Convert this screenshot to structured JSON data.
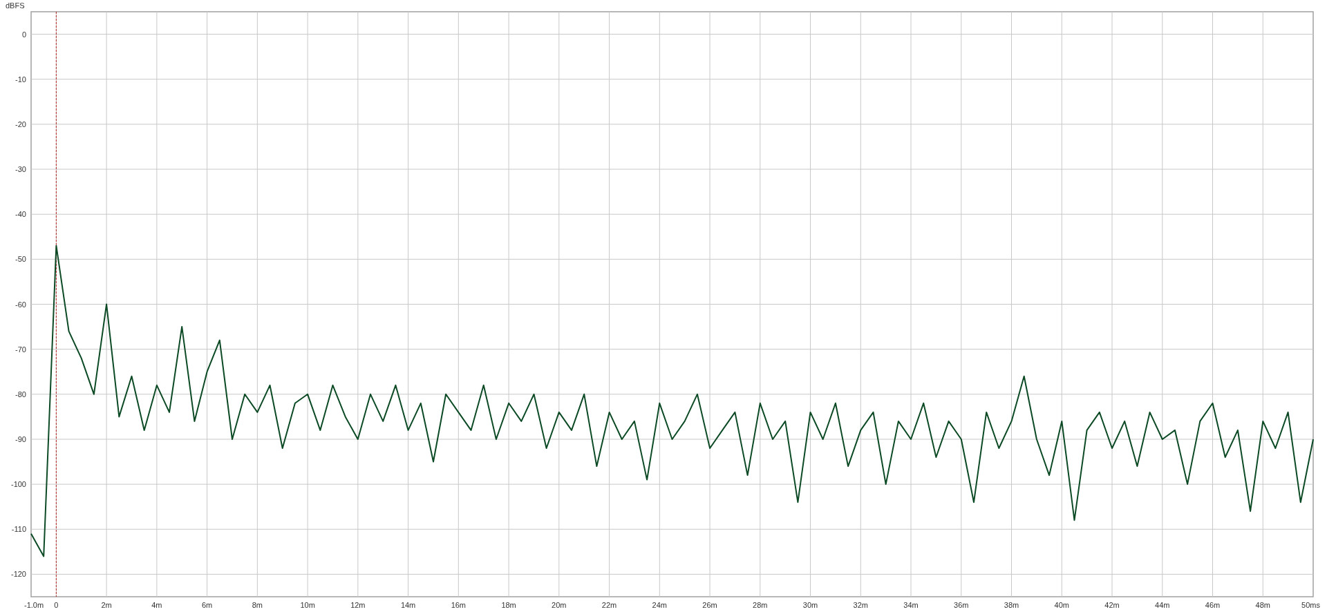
{
  "chart_data": {
    "type": "line",
    "ylabel": "dBFS",
    "xlim": [
      -1,
      50
    ],
    "ylim": [
      -125,
      5
    ],
    "grid": true,
    "ref_lines": [
      {
        "axis": "x",
        "value": 0,
        "color": "#b22222"
      }
    ],
    "xticks": [
      {
        "value": -1,
        "label": "-1.0m"
      },
      {
        "value": 0,
        "label": "0"
      },
      {
        "value": 2,
        "label": "2m"
      },
      {
        "value": 4,
        "label": "4m"
      },
      {
        "value": 6,
        "label": "6m"
      },
      {
        "value": 8,
        "label": "8m"
      },
      {
        "value": 10,
        "label": "10m"
      },
      {
        "value": 12,
        "label": "12m"
      },
      {
        "value": 14,
        "label": "14m"
      },
      {
        "value": 16,
        "label": "16m"
      },
      {
        "value": 18,
        "label": "18m"
      },
      {
        "value": 20,
        "label": "20m"
      },
      {
        "value": 22,
        "label": "22m"
      },
      {
        "value": 24,
        "label": "24m"
      },
      {
        "value": 26,
        "label": "26m"
      },
      {
        "value": 28,
        "label": "28m"
      },
      {
        "value": 30,
        "label": "30m"
      },
      {
        "value": 32,
        "label": "32m"
      },
      {
        "value": 34,
        "label": "34m"
      },
      {
        "value": 36,
        "label": "36m"
      },
      {
        "value": 38,
        "label": "38m"
      },
      {
        "value": 40,
        "label": "40m"
      },
      {
        "value": 42,
        "label": "42m"
      },
      {
        "value": 44,
        "label": "44m"
      },
      {
        "value": 46,
        "label": "46m"
      },
      {
        "value": 48,
        "label": "48m"
      },
      {
        "value": 50,
        "label": "50ms"
      }
    ],
    "yticks": [
      0,
      -10,
      -20,
      -30,
      -40,
      -50,
      -60,
      -70,
      -80,
      -90,
      -100,
      -110,
      -120
    ],
    "x": [
      -1,
      -0.5,
      0,
      0.5,
      1,
      1.5,
      2,
      2.5,
      3,
      3.5,
      4,
      4.5,
      5,
      5.5,
      6,
      6.5,
      7,
      7.5,
      8,
      8.5,
      9,
      9.5,
      10,
      10.5,
      11,
      11.5,
      12,
      12.5,
      13,
      13.5,
      14,
      14.5,
      15,
      15.5,
      16,
      16.5,
      17,
      17.5,
      18,
      18.5,
      19,
      19.5,
      20,
      20.5,
      21,
      21.5,
      22,
      22.5,
      23,
      23.5,
      24,
      24.5,
      25,
      25.5,
      26,
      26.5,
      27,
      27.5,
      28,
      28.5,
      29,
      29.5,
      30,
      30.5,
      31,
      31.5,
      32,
      32.5,
      33,
      33.5,
      34,
      34.5,
      35,
      35.5,
      36,
      36.5,
      37,
      37.5,
      38,
      38.5,
      39,
      39.5,
      40,
      40.5,
      41,
      41.5,
      42,
      42.5,
      43,
      43.5,
      44,
      44.5,
      45,
      45.5,
      46,
      46.5,
      47,
      47.5,
      48,
      48.5,
      49,
      49.5,
      50
    ],
    "series": [
      {
        "color": "#0b4a24",
        "values": [
          -111,
          -116,
          -47,
          -66,
          -72,
          -80,
          -60,
          -85,
          -76,
          -88,
          -78,
          -84,
          -65,
          -86,
          -75,
          -68,
          -90,
          -80,
          -84,
          -78,
          -92,
          -82,
          -80,
          -88,
          -78,
          -85,
          -90,
          -80,
          -86,
          -78,
          -88,
          -82,
          -95,
          -80,
          -84,
          -88,
          -78,
          -90,
          -82,
          -86,
          -80,
          -92,
          -84,
          -88,
          -80,
          -96,
          -84,
          -90,
          -86,
          -99,
          -82,
          -90,
          -86,
          -80,
          -92,
          -88,
          -84,
          -98,
          -82,
          -90,
          -86,
          -104,
          -84,
          -90,
          -82,
          -96,
          -88,
          -84,
          -100,
          -86,
          -90,
          -82,
          -94,
          -86,
          -90,
          -104,
          -84,
          -92,
          -86,
          -76,
          -90,
          -98,
          -86,
          -108,
          -88,
          -84,
          -92,
          -86,
          -96,
          -84,
          -90,
          -88,
          -100,
          -86,
          -82,
          -94,
          -88,
          -106,
          -86,
          -92,
          -84,
          -104,
          -90
        ]
      }
    ]
  }
}
